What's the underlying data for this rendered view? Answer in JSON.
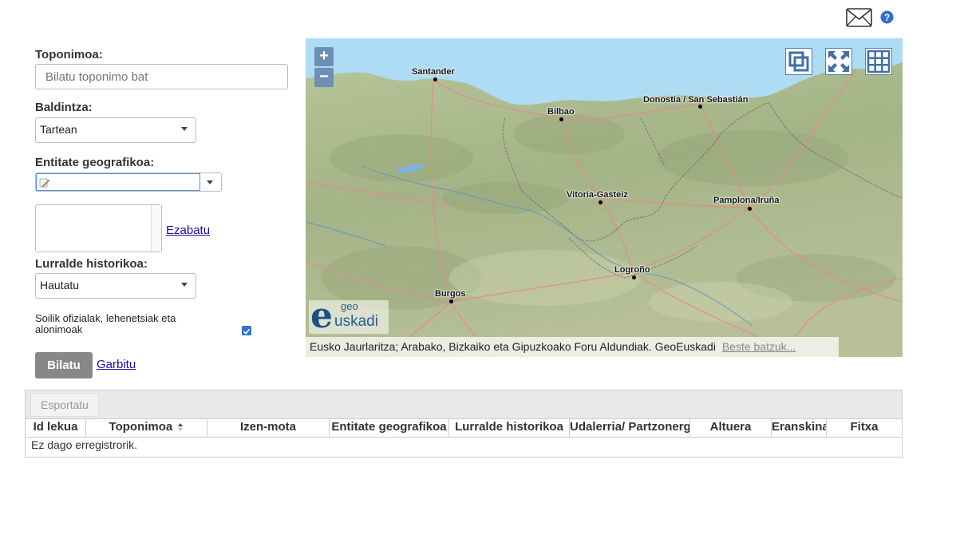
{
  "header": {
    "mail_icon": "envelope-icon",
    "help_icon": "question-icon"
  },
  "form": {
    "toponym_label": "Toponimoa:",
    "toponym_placeholder": "Bilatu toponimo bat",
    "condition_label": "Baldintza:",
    "condition_value": "Tartean",
    "entity_label": "Entitate geografikoa:",
    "entity_value": "",
    "delete_link": "Ezabatu",
    "region_label": "Lurralde historikoa:",
    "region_value": "Hautatu",
    "official_label": "Soilik ofizialak, lehenetsiak eta alonimoak",
    "official_checked": true,
    "search_button": "Bilatu",
    "clear_link": "Garbitu"
  },
  "map": {
    "zoom_in": "+",
    "zoom_out": "−",
    "cities": [
      {
        "name": "Santander"
      },
      {
        "name": "Bilbao"
      },
      {
        "name": "Donostia / San Sebastián"
      },
      {
        "name": "Vitoria-Gasteiz"
      },
      {
        "name": "Pamplona/Iruña"
      },
      {
        "name": "Logroño"
      },
      {
        "name": "Burgos"
      }
    ],
    "logo_geo": "geo",
    "logo_e": "e",
    "logo_uskadi": "uskadi",
    "attribution": "Eusko Jaurlaritza; Arabako, Bizkaiko eta Gipuzkoako Foru Aldundiak. GeoEuskadi",
    "more_link": "Beste batzuk...",
    "colors": {
      "sea": "#aedcf4",
      "land": "#a9b98a",
      "road": "#e58a8a"
    }
  },
  "results": {
    "export_button": "Esportatu",
    "columns": [
      "Id lekua",
      "Toponimoa",
      "Izen-mota",
      "Entitate geografikoa",
      "Lurralde historikoa",
      "Udalerria/ Partzonergoa",
      "Altuera",
      "Eranskina",
      "Fitxa"
    ],
    "empty_text": "Ez dago erregistrorik."
  }
}
